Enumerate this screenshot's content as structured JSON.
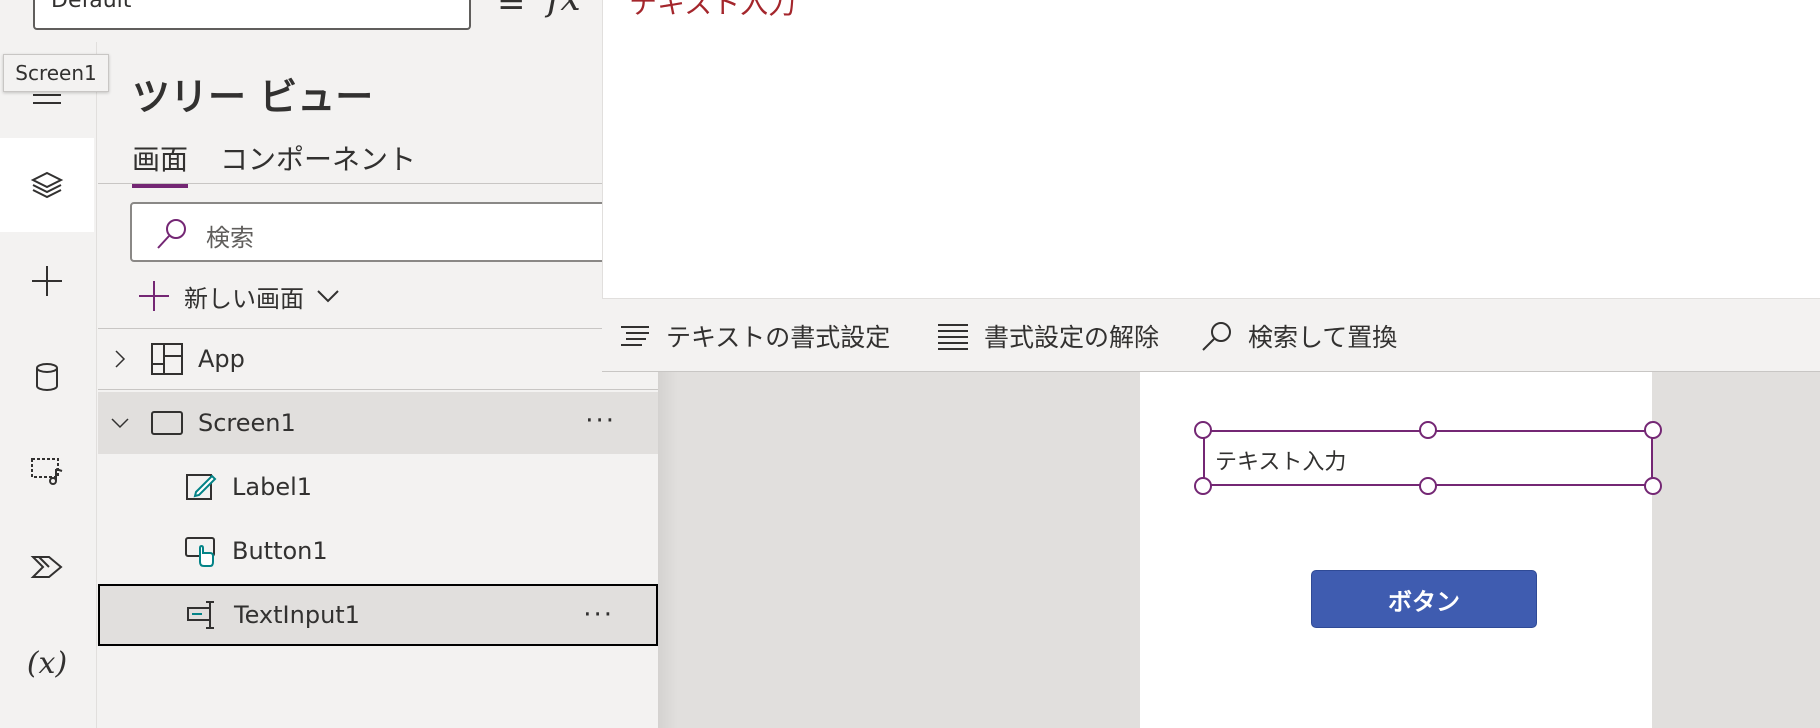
{
  "topbar": {
    "property_value": "Default",
    "equals": "=",
    "fx": "fx"
  },
  "tooltip": "Screen1",
  "rail": {
    "items": [
      {
        "name": "hamburger-icon"
      },
      {
        "name": "layers-icon",
        "active": true
      },
      {
        "name": "plus-icon"
      },
      {
        "name": "database-icon"
      },
      {
        "name": "media-icon"
      },
      {
        "name": "power-automate-icon"
      },
      {
        "name": "variables-icon",
        "text": "(x)"
      }
    ]
  },
  "tree": {
    "title": "ツリー ビュー",
    "tabs": [
      {
        "label": "画面"
      },
      {
        "label": "コンポーネント"
      }
    ],
    "search_placeholder": "検索",
    "new_screen": "新しい画面",
    "nodes": {
      "app": "App",
      "screen1": "Screen1",
      "label1": "Label1",
      "button1": "Button1",
      "textinput1": "TextInput1"
    },
    "more": "···"
  },
  "formula": {
    "code": "テキスト入力"
  },
  "toolbar": {
    "format_text": "テキストの書式設定",
    "remove_format": "書式設定の解除",
    "find_replace": "検索して置換"
  },
  "canvas": {
    "text_input_value": "テキスト入力",
    "button_label": "ボタン"
  },
  "colors": {
    "accent": "#742774",
    "button": "#3f5cb0",
    "formula_text": "#a4262c"
  }
}
